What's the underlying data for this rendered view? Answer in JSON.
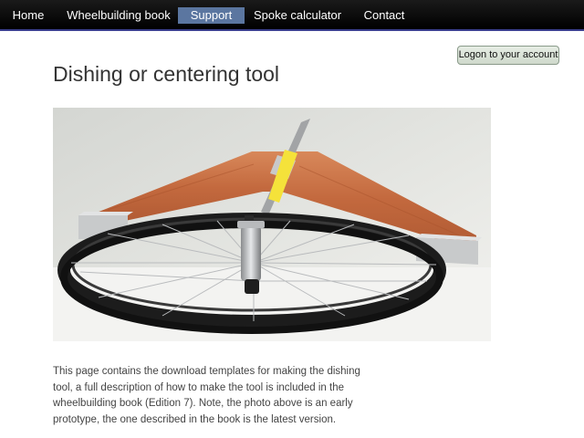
{
  "nav": {
    "items": [
      {
        "label": "Home"
      },
      {
        "label": "Wheelbuilding book"
      },
      {
        "label": "Support",
        "active": true
      },
      {
        "label": "Spoke calculator"
      },
      {
        "label": "Contact"
      }
    ],
    "active_color": "#5b76a0"
  },
  "account": {
    "logon_label": "Logon to your account"
  },
  "page": {
    "title": "Dishing or centering tool",
    "intro": "This page contains the download templates for making the dishing tool, a full description of how to make the tool is included in the wheelbuilding book (Edition 7). Note, the photo above is an early prototype, the one described in the book is the latest version."
  }
}
